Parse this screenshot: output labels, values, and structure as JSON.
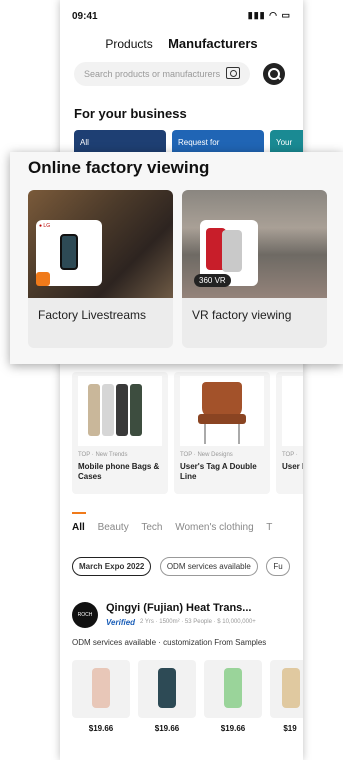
{
  "status_bar": {
    "time": "09:41",
    "icons": "signal wifi battery"
  },
  "top_tabs": [
    {
      "label": "Products",
      "active": false
    },
    {
      "label": "Manufacturers",
      "active": true
    }
  ],
  "search": {
    "placeholder": "Search products or manufacturers",
    "camera_icon": "camera-icon",
    "search_icon": "search-icon"
  },
  "business": {
    "title": "For your business",
    "cards": [
      {
        "label": "All",
        "color": "#1e3f73"
      },
      {
        "label": "Request for",
        "color": "#2065b5"
      },
      {
        "label": "Your",
        "color": "#1a8a93"
      }
    ]
  },
  "online_factory": {
    "title": "Online factory viewing",
    "cards": [
      {
        "label": "Factory Livestreams",
        "badge": "live-icon"
      },
      {
        "label": "VR factory viewing",
        "badge": "360 VR"
      }
    ]
  },
  "products": [
    {
      "meta": "TOP · New Trends",
      "name": "Mobile phone Bags & Cases"
    },
    {
      "meta": "TOP · New Designs",
      "name": "User's Tag A Double Line"
    },
    {
      "meta": "TOP ·",
      "name": "User Doub"
    }
  ],
  "category_tabs": [
    "All",
    "Beauty",
    "Tech",
    "Women's clothing",
    "T"
  ],
  "chips": [
    {
      "label": "March Expo 2022",
      "active": true
    },
    {
      "label": "ODM services available",
      "active": false
    },
    {
      "label": "Fu",
      "active": false
    }
  ],
  "supplier": {
    "logo_text": "ROCH",
    "name": "Qingyi (Fujian) Heat Trans...",
    "verified": "Verified",
    "info": "2 Yrs · 1500m² · 53 People · $ 10,000,000+",
    "description": "ODM services available · customization From Samples",
    "items": [
      {
        "price": "$19.66",
        "color": "#e8c7b8"
      },
      {
        "price": "$19.66",
        "color": "#2d4a55"
      },
      {
        "price": "$19.66",
        "color": "#9ad49a"
      },
      {
        "price": "$19",
        "color": "#e0c9a0"
      }
    ]
  }
}
